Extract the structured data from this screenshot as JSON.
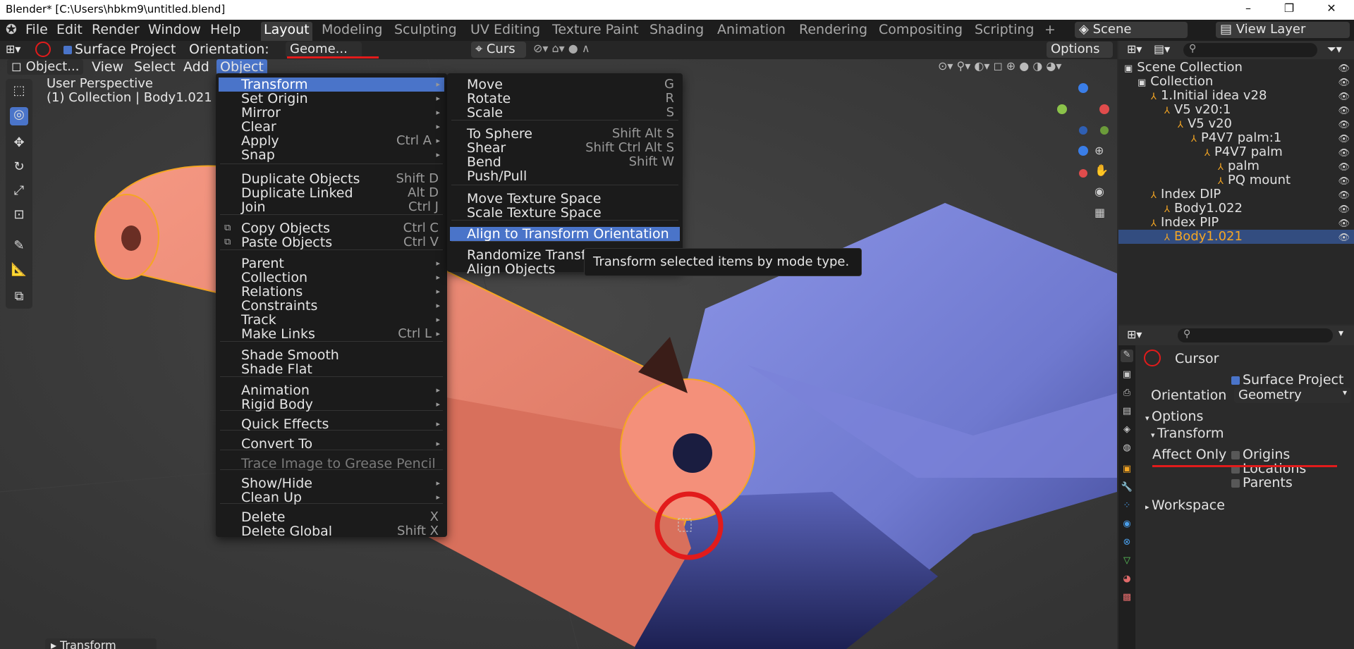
{
  "window": {
    "title": "Blender* [C:\\Users\\hbkm9\\untitled.blend]",
    "minimize": "–",
    "maximize": "❐",
    "close": "✕"
  },
  "topbar": {
    "menus": [
      "File",
      "Edit",
      "Render",
      "Window",
      "Help"
    ],
    "workspaces": [
      "Layout",
      "Modeling",
      "Sculpting",
      "UV Editing",
      "Texture Paint",
      "Shading",
      "Animation",
      "Rendering",
      "Compositing",
      "Scripting"
    ],
    "add_tab": "+",
    "scene": "Scene",
    "view_layer": "View Layer"
  },
  "header": {
    "surface_project": "Surface Project",
    "orientation_label": "Orientation:",
    "orientation_value": "Geome...",
    "pivot": "Curs",
    "options": "Options"
  },
  "vpmenu": {
    "mode": "Object...",
    "items": [
      "View",
      "Select",
      "Add",
      "Object"
    ]
  },
  "viewport": {
    "perspective": "User Perspective",
    "collection_info": "(1) Collection | Body1.021",
    "last_op": "Transform"
  },
  "object_menu": [
    {
      "label": "Transform",
      "sub": true,
      "hl": true
    },
    {
      "label": "Set Origin",
      "sub": true
    },
    {
      "label": "Mirror",
      "sub": true
    },
    {
      "label": "Clear",
      "sub": true
    },
    {
      "label": "Apply",
      "shortcut": "Ctrl A",
      "sub": true
    },
    {
      "label": "Snap",
      "sub": true
    },
    {
      "label": "Duplicate Objects",
      "shortcut": "Shift D"
    },
    {
      "label": "Duplicate Linked",
      "shortcut": "Alt D"
    },
    {
      "label": "Join",
      "shortcut": "Ctrl J"
    },
    {
      "label": "Copy Objects",
      "shortcut": "Ctrl C"
    },
    {
      "label": "Paste Objects",
      "shortcut": "Ctrl V"
    },
    {
      "label": "Parent",
      "sub": true
    },
    {
      "label": "Collection",
      "sub": true
    },
    {
      "label": "Relations",
      "sub": true
    },
    {
      "label": "Constraints",
      "sub": true
    },
    {
      "label": "Track",
      "sub": true
    },
    {
      "label": "Make Links",
      "shortcut": "Ctrl L",
      "sub": true
    },
    {
      "label": "Shade Smooth"
    },
    {
      "label": "Shade Flat"
    },
    {
      "label": "Animation",
      "sub": true
    },
    {
      "label": "Rigid Body",
      "sub": true
    },
    {
      "label": "Quick Effects",
      "sub": true
    },
    {
      "label": "Convert To",
      "sub": true
    },
    {
      "label": "Trace Image to Grease Pencil",
      "disabled": true
    },
    {
      "label": "Show/Hide",
      "sub": true
    },
    {
      "label": "Clean Up",
      "sub": true
    },
    {
      "label": "Delete",
      "shortcut": "X"
    },
    {
      "label": "Delete Global",
      "shortcut": "Shift X"
    }
  ],
  "transform_menu": [
    {
      "label": "Move",
      "shortcut": "G"
    },
    {
      "label": "Rotate",
      "shortcut": "R"
    },
    {
      "label": "Scale",
      "shortcut": "S"
    },
    {
      "label": "To Sphere",
      "shortcut": "Shift Alt S"
    },
    {
      "label": "Shear",
      "shortcut": "Shift Ctrl Alt S"
    },
    {
      "label": "Bend",
      "shortcut": "Shift W"
    },
    {
      "label": "Push/Pull"
    },
    {
      "label": "Move Texture Space"
    },
    {
      "label": "Scale Texture Space"
    },
    {
      "label": "Align to Transform Orientation",
      "hl": true
    },
    {
      "label": "Randomize Transform"
    },
    {
      "label": "Align Objects"
    }
  ],
  "tooltip": "Transform selected items by mode type.",
  "outliner": [
    {
      "label": "Scene Collection",
      "indent": 0
    },
    {
      "label": "Collection",
      "indent": 1
    },
    {
      "label": "1.Initial idea v28",
      "indent": 2
    },
    {
      "label": "V5 v20:1",
      "indent": 3
    },
    {
      "label": "V5 v20",
      "indent": 4
    },
    {
      "label": "P4V7 palm:1",
      "indent": 5
    },
    {
      "label": "P4V7 palm",
      "indent": 6
    },
    {
      "label": "palm",
      "indent": 7
    },
    {
      "label": "PQ mount",
      "indent": 7
    },
    {
      "label": "Index DIP",
      "indent": 2
    },
    {
      "label": "Body1.022",
      "indent": 3
    },
    {
      "label": "Index PIP",
      "indent": 2
    },
    {
      "label": "Body1.021",
      "indent": 3,
      "selected": true
    }
  ],
  "props": {
    "tool": "Cursor",
    "surface_project": "Surface Project",
    "orientation_label": "Orientation",
    "orientation_value": "Geometry",
    "options": "Options",
    "transform": "Transform",
    "affect_only": "Affect Only",
    "origins": "Origins",
    "locations": "Locations",
    "parents": "Parents",
    "workspace": "Workspace"
  },
  "colors": {
    "accent": "#4a74c9",
    "annotation": "#e21b1b",
    "salmon_body": "#f08a74",
    "blue_body": "#7d86dc"
  }
}
